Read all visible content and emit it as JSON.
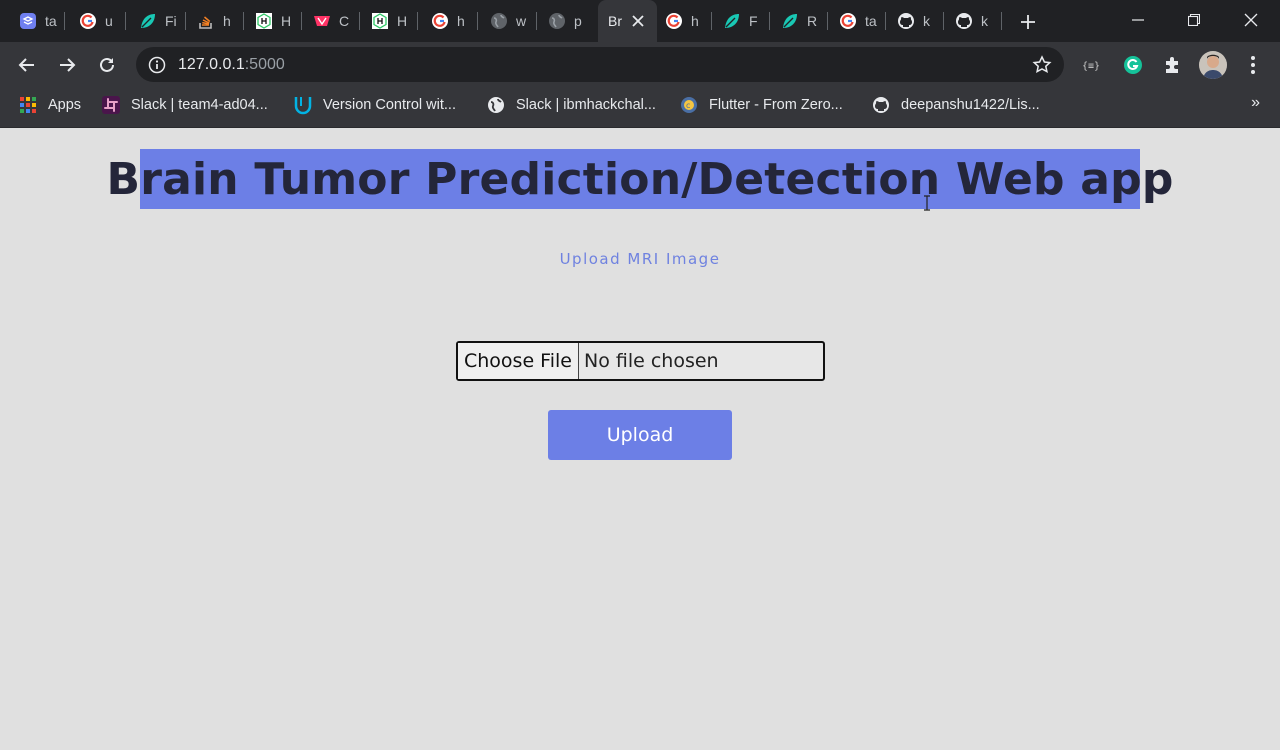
{
  "browser": {
    "tabs": [
      {
        "label": "ta",
        "icon": "layers-icon"
      },
      {
        "label": "u",
        "icon": "google-icon"
      },
      {
        "label": "Fi",
        "icon": "leaf-icon"
      },
      {
        "label": "h",
        "icon": "stack-overflow-icon"
      },
      {
        "label": "H",
        "icon": "hackerrank-icon"
      },
      {
        "label": "C",
        "icon": "codepen-icon"
      },
      {
        "label": "H",
        "icon": "hackerrank-icon"
      },
      {
        "label": "h",
        "icon": "google-icon"
      },
      {
        "label": "w",
        "icon": "globe-icon"
      },
      {
        "label": "p",
        "icon": "globe-icon"
      },
      {
        "label": "Br",
        "icon": "none",
        "active": true
      },
      {
        "label": "h",
        "icon": "google-icon"
      },
      {
        "label": "F",
        "icon": "leaf-icon"
      },
      {
        "label": "R",
        "icon": "leaf-icon"
      },
      {
        "label": "ta",
        "icon": "google-icon"
      },
      {
        "label": "k",
        "icon": "github-icon"
      },
      {
        "label": "k",
        "icon": "github-icon"
      }
    ],
    "address": {
      "host": "127.0.0.1",
      "port": ":5000"
    },
    "bookmarks": [
      {
        "label": "Apps",
        "icon": "apps-grid-icon"
      },
      {
        "label": "Slack | team4-ad04...",
        "icon": "slack-icon"
      },
      {
        "label": "Version Control wit...",
        "icon": "udacity-icon"
      },
      {
        "label": "Slack | ibmhackchal...",
        "icon": "globe-icon"
      },
      {
        "label": "Flutter - From Zero...",
        "icon": "badge-icon"
      },
      {
        "label": "deepanshu1422/Lis...",
        "icon": "github-icon"
      }
    ],
    "more_bookmarks": "»"
  },
  "page": {
    "title": "Brain Tumor Prediction/Detection Web app",
    "subtitle": "Upload MRI Image",
    "file_button": "Choose File",
    "file_status": "No file chosen",
    "upload_button": "Upload"
  },
  "colors": {
    "accent": "#6c7fe6",
    "page_bg": "#e0e0e0",
    "chrome_dark": "#202124",
    "chrome_toolbar": "#35363a"
  }
}
